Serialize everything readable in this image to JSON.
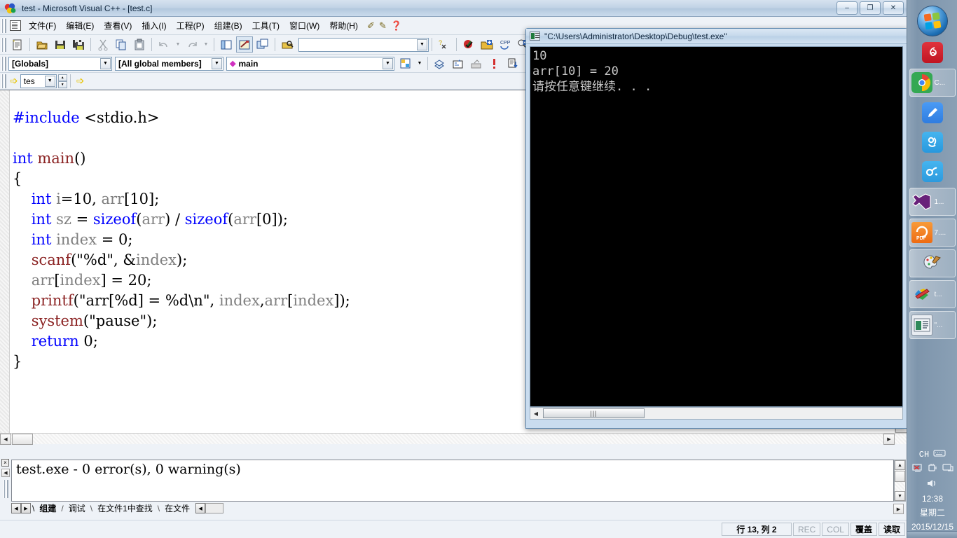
{
  "window": {
    "title": "test - Microsoft Visual C++ - [test.c]",
    "minimize": "–",
    "maximize": "❐",
    "close": "✕"
  },
  "menu": {
    "items": [
      {
        "label": "文件(F)"
      },
      {
        "label": "编辑(E)"
      },
      {
        "label": "查看(V)"
      },
      {
        "label": "插入(I)"
      },
      {
        "label": "工程(P)"
      },
      {
        "label": "组建(B)"
      },
      {
        "label": "工具(T)"
      },
      {
        "label": "窗口(W)"
      },
      {
        "label": "帮助(H)"
      }
    ]
  },
  "toolbar_standard": {
    "buttons": [
      {
        "name": "new-text-file",
        "glyph": "📄"
      },
      {
        "name": "open-file",
        "glyph": "📂"
      },
      {
        "name": "save",
        "glyph": "💾"
      },
      {
        "name": "save-all",
        "glyph": "🗐"
      },
      {
        "name": "cut",
        "glyph": "✂"
      },
      {
        "name": "copy",
        "glyph": "⧉"
      },
      {
        "name": "paste",
        "glyph": "📋"
      },
      {
        "name": "undo",
        "glyph": "↶"
      },
      {
        "name": "redo",
        "glyph": "↷"
      },
      {
        "name": "workspace",
        "glyph": "▤"
      },
      {
        "name": "output-window",
        "glyph": "▣"
      },
      {
        "name": "window-list",
        "glyph": "❑"
      },
      {
        "name": "find-in-files",
        "glyph": "🔍"
      }
    ],
    "search_value": "",
    "help_glyph": "?"
  },
  "toolbar_build": {
    "buttons": [
      {
        "name": "compile",
        "glyph": "✓"
      },
      {
        "name": "build",
        "glyph": "▦"
      },
      {
        "name": "build-execute",
        "glyph": "↻"
      },
      {
        "name": "stop-build",
        "glyph": "▮"
      },
      {
        "name": "execute-program",
        "glyph": "!"
      },
      {
        "name": "go",
        "glyph": "▶"
      },
      {
        "name": "insert-breakpoint",
        "glyph": "●"
      },
      {
        "name": "pause",
        "glyph": "✋"
      }
    ]
  },
  "combos": {
    "globals": "[Globals]",
    "members": "[All global members]",
    "symbol": "main",
    "symbol_marker": "◆",
    "arrow": "▼"
  },
  "wizardbar": {
    "project": "tes",
    "arrow_glyph": "➩"
  },
  "editor": {
    "code_lines": [
      "#include <stdio.h>",
      "",
      "int main()",
      "{",
      "    int i=10, arr[10];",
      "    int sz = sizeof(arr) / sizeof(arr[0]);",
      "    int index = 0;",
      "    scanf(\"%d\", &index);",
      "    arr[index] = 20;",
      "    printf(\"arr[%d] = %d\\n\", index,arr[index]);",
      "    system(\"pause\");",
      "    return 0;",
      "}"
    ]
  },
  "output": {
    "text": "test.exe - 0 error(s), 0 warning(s)",
    "close_glyph": "×",
    "tabs": [
      {
        "label": "组建",
        "active": true
      },
      {
        "label": "调试",
        "active": false
      },
      {
        "label": "在文件1中查找",
        "active": false
      },
      {
        "label": "在文件",
        "active": false
      }
    ],
    "nav_prev": "◀",
    "nav_next": "▶"
  },
  "statusbar": {
    "position": "行 13, 列 2",
    "cells": [
      {
        "label": "REC",
        "state": "off"
      },
      {
        "label": "COL",
        "state": "off"
      },
      {
        "label": "覆盖",
        "state": "on"
      },
      {
        "label": "读取",
        "state": "on"
      }
    ]
  },
  "console": {
    "title": "\"C:\\Users\\Administrator\\Desktop\\Debug\\test.exe\"",
    "lines": [
      "10",
      "arr[10] = 20",
      "请按任意键继续. . ."
    ],
    "scroll_left_glyph": "◀",
    "scroll_thumb_glyph": "|||"
  },
  "taskbar": {
    "start_label": "start-orb",
    "items": [
      {
        "name": "netease-music",
        "glyph": "❂",
        "color": "#c8202a",
        "label": ""
      },
      {
        "name": "google-chrome",
        "glyph": "◉",
        "color": "#dd4b39",
        "label": "C..."
      },
      {
        "name": "note-pencil",
        "glyph": "✎",
        "color": "#3b8cf0",
        "label": ""
      },
      {
        "name": "contacts-app",
        "glyph": "☏",
        "color": "#3aa6e8",
        "label": ""
      },
      {
        "name": "cloud-link",
        "glyph": "∞",
        "color": "#35a8e0",
        "label": ""
      },
      {
        "name": "visual-studio",
        "glyph": "✖",
        "color": "#68217a",
        "label": "1..."
      },
      {
        "name": "pdf-reader",
        "glyph": "G",
        "color": "#f07b22",
        "label": "7...."
      },
      {
        "name": "paint",
        "glyph": "🎨",
        "color": "#dfe6ee",
        "label": ""
      },
      {
        "name": "visual-cpp",
        "glyph": "◆",
        "color": "#e8ecf1",
        "label": "t..."
      },
      {
        "name": "console-window",
        "glyph": "▤",
        "color": "#e8ecf1",
        "label": "\"..."
      }
    ],
    "tray": {
      "ime": "CH",
      "keyboard_icon": "⌨",
      "network_x_icon": "⊠",
      "plug_icon": "🔌",
      "monitor_icon": "🖥",
      "volume_icon": "🔊",
      "time": "12:38",
      "weekday": "星期二",
      "date": "2015/12/15"
    }
  }
}
